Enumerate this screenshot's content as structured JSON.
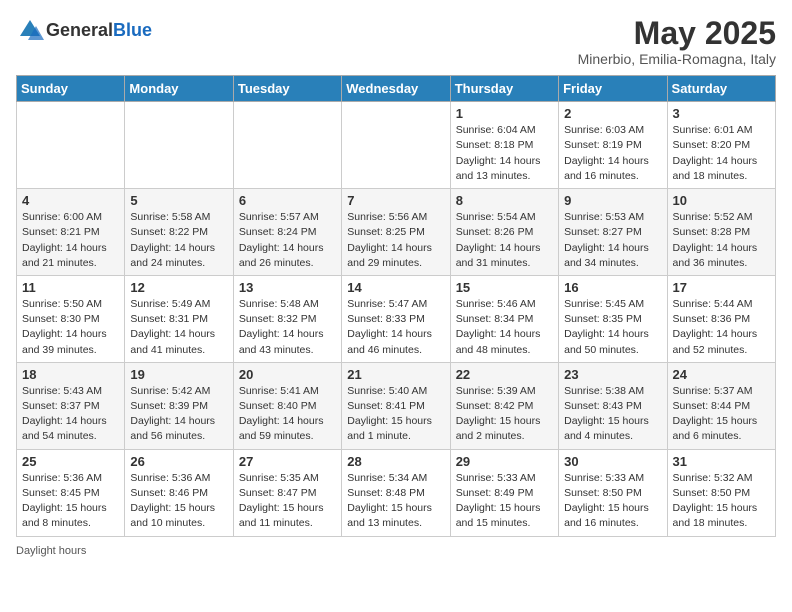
{
  "header": {
    "logo_general": "General",
    "logo_blue": "Blue",
    "month_title": "May 2025",
    "location": "Minerbio, Emilia-Romagna, Italy"
  },
  "days_of_week": [
    "Sunday",
    "Monday",
    "Tuesday",
    "Wednesday",
    "Thursday",
    "Friday",
    "Saturday"
  ],
  "footer": {
    "daylight_label": "Daylight hours"
  },
  "weeks": [
    [
      {
        "day": "",
        "info": ""
      },
      {
        "day": "",
        "info": ""
      },
      {
        "day": "",
        "info": ""
      },
      {
        "day": "",
        "info": ""
      },
      {
        "day": "1",
        "info": "Sunrise: 6:04 AM\nSunset: 8:18 PM\nDaylight: 14 hours\nand 13 minutes."
      },
      {
        "day": "2",
        "info": "Sunrise: 6:03 AM\nSunset: 8:19 PM\nDaylight: 14 hours\nand 16 minutes."
      },
      {
        "day": "3",
        "info": "Sunrise: 6:01 AM\nSunset: 8:20 PM\nDaylight: 14 hours\nand 18 minutes."
      }
    ],
    [
      {
        "day": "4",
        "info": "Sunrise: 6:00 AM\nSunset: 8:21 PM\nDaylight: 14 hours\nand 21 minutes."
      },
      {
        "day": "5",
        "info": "Sunrise: 5:58 AM\nSunset: 8:22 PM\nDaylight: 14 hours\nand 24 minutes."
      },
      {
        "day": "6",
        "info": "Sunrise: 5:57 AM\nSunset: 8:24 PM\nDaylight: 14 hours\nand 26 minutes."
      },
      {
        "day": "7",
        "info": "Sunrise: 5:56 AM\nSunset: 8:25 PM\nDaylight: 14 hours\nand 29 minutes."
      },
      {
        "day": "8",
        "info": "Sunrise: 5:54 AM\nSunset: 8:26 PM\nDaylight: 14 hours\nand 31 minutes."
      },
      {
        "day": "9",
        "info": "Sunrise: 5:53 AM\nSunset: 8:27 PM\nDaylight: 14 hours\nand 34 minutes."
      },
      {
        "day": "10",
        "info": "Sunrise: 5:52 AM\nSunset: 8:28 PM\nDaylight: 14 hours\nand 36 minutes."
      }
    ],
    [
      {
        "day": "11",
        "info": "Sunrise: 5:50 AM\nSunset: 8:30 PM\nDaylight: 14 hours\nand 39 minutes."
      },
      {
        "day": "12",
        "info": "Sunrise: 5:49 AM\nSunset: 8:31 PM\nDaylight: 14 hours\nand 41 minutes."
      },
      {
        "day": "13",
        "info": "Sunrise: 5:48 AM\nSunset: 8:32 PM\nDaylight: 14 hours\nand 43 minutes."
      },
      {
        "day": "14",
        "info": "Sunrise: 5:47 AM\nSunset: 8:33 PM\nDaylight: 14 hours\nand 46 minutes."
      },
      {
        "day": "15",
        "info": "Sunrise: 5:46 AM\nSunset: 8:34 PM\nDaylight: 14 hours\nand 48 minutes."
      },
      {
        "day": "16",
        "info": "Sunrise: 5:45 AM\nSunset: 8:35 PM\nDaylight: 14 hours\nand 50 minutes."
      },
      {
        "day": "17",
        "info": "Sunrise: 5:44 AM\nSunset: 8:36 PM\nDaylight: 14 hours\nand 52 minutes."
      }
    ],
    [
      {
        "day": "18",
        "info": "Sunrise: 5:43 AM\nSunset: 8:37 PM\nDaylight: 14 hours\nand 54 minutes."
      },
      {
        "day": "19",
        "info": "Sunrise: 5:42 AM\nSunset: 8:39 PM\nDaylight: 14 hours\nand 56 minutes."
      },
      {
        "day": "20",
        "info": "Sunrise: 5:41 AM\nSunset: 8:40 PM\nDaylight: 14 hours\nand 59 minutes."
      },
      {
        "day": "21",
        "info": "Sunrise: 5:40 AM\nSunset: 8:41 PM\nDaylight: 15 hours\nand 1 minute."
      },
      {
        "day": "22",
        "info": "Sunrise: 5:39 AM\nSunset: 8:42 PM\nDaylight: 15 hours\nand 2 minutes."
      },
      {
        "day": "23",
        "info": "Sunrise: 5:38 AM\nSunset: 8:43 PM\nDaylight: 15 hours\nand 4 minutes."
      },
      {
        "day": "24",
        "info": "Sunrise: 5:37 AM\nSunset: 8:44 PM\nDaylight: 15 hours\nand 6 minutes."
      }
    ],
    [
      {
        "day": "25",
        "info": "Sunrise: 5:36 AM\nSunset: 8:45 PM\nDaylight: 15 hours\nand 8 minutes."
      },
      {
        "day": "26",
        "info": "Sunrise: 5:36 AM\nSunset: 8:46 PM\nDaylight: 15 hours\nand 10 minutes."
      },
      {
        "day": "27",
        "info": "Sunrise: 5:35 AM\nSunset: 8:47 PM\nDaylight: 15 hours\nand 11 minutes."
      },
      {
        "day": "28",
        "info": "Sunrise: 5:34 AM\nSunset: 8:48 PM\nDaylight: 15 hours\nand 13 minutes."
      },
      {
        "day": "29",
        "info": "Sunrise: 5:33 AM\nSunset: 8:49 PM\nDaylight: 15 hours\nand 15 minutes."
      },
      {
        "day": "30",
        "info": "Sunrise: 5:33 AM\nSunset: 8:50 PM\nDaylight: 15 hours\nand 16 minutes."
      },
      {
        "day": "31",
        "info": "Sunrise: 5:32 AM\nSunset: 8:50 PM\nDaylight: 15 hours\nand 18 minutes."
      }
    ]
  ]
}
